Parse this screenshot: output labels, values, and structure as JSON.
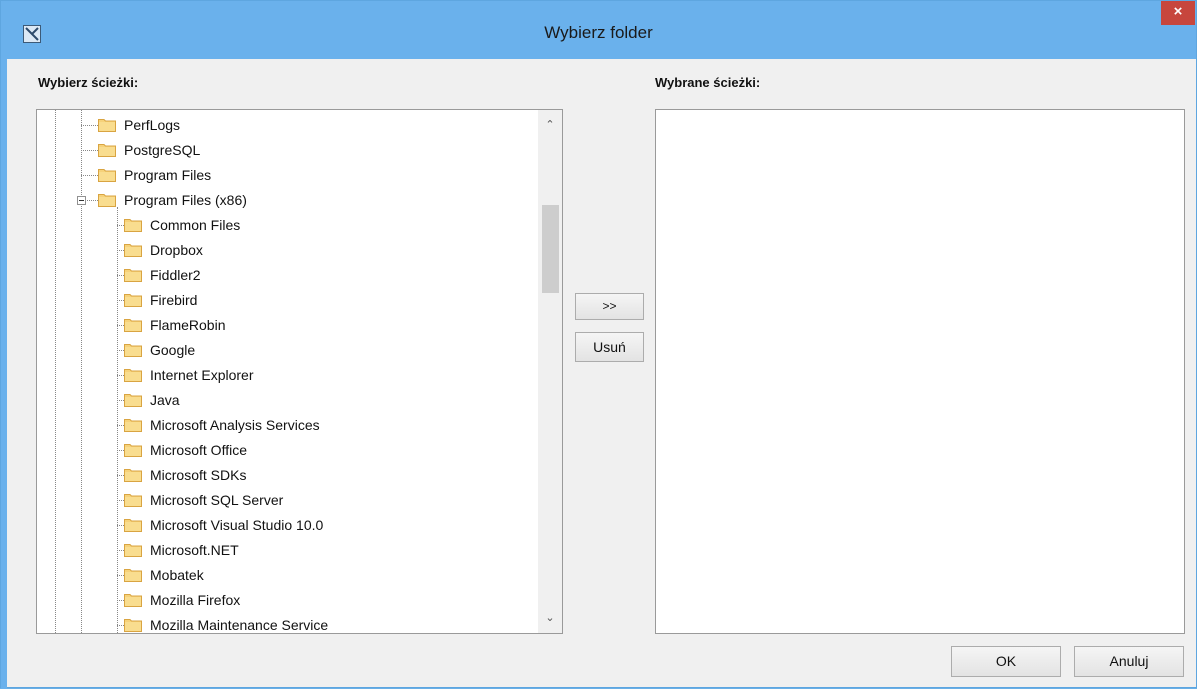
{
  "window": {
    "title": "Wybierz folder",
    "close_label": "×",
    "accent_color": "#6ab1ec",
    "close_color": "#c7463d"
  },
  "left_panel": {
    "label": "Wybierz ścieżki:",
    "tree": [
      {
        "label": "PerfLogs",
        "level": 1
      },
      {
        "label": "PostgreSQL",
        "level": 1
      },
      {
        "label": "Program Files",
        "level": 1
      },
      {
        "label": "Program Files (x86)",
        "level": 1,
        "expanded": true
      },
      {
        "label": "Common Files",
        "level": 2
      },
      {
        "label": "Dropbox",
        "level": 2
      },
      {
        "label": "Fiddler2",
        "level": 2
      },
      {
        "label": "Firebird",
        "level": 2
      },
      {
        "label": "FlameRobin",
        "level": 2
      },
      {
        "label": "Google",
        "level": 2
      },
      {
        "label": "Internet Explorer",
        "level": 2
      },
      {
        "label": "Java",
        "level": 2
      },
      {
        "label": "Microsoft Analysis Services",
        "level": 2
      },
      {
        "label": "Microsoft Office",
        "level": 2
      },
      {
        "label": "Microsoft SDKs",
        "level": 2
      },
      {
        "label": "Microsoft SQL Server",
        "level": 2
      },
      {
        "label": "Microsoft Visual Studio 10.0",
        "level": 2
      },
      {
        "label": "Microsoft.NET",
        "level": 2
      },
      {
        "label": "Mobatek",
        "level": 2
      },
      {
        "label": "Mozilla Firefox",
        "level": 2
      },
      {
        "label": "Mozilla Maintenance Service",
        "level": 2
      }
    ]
  },
  "right_panel": {
    "label": "Wybrane ścieżki:"
  },
  "buttons": {
    "add": ">>",
    "remove": "Usuń",
    "ok": "OK",
    "cancel": "Anuluj"
  },
  "icons": {
    "app": "app-icon",
    "folder": "folder-icon",
    "scroll_up": "chevron-up-icon",
    "scroll_down": "chevron-down-icon"
  }
}
